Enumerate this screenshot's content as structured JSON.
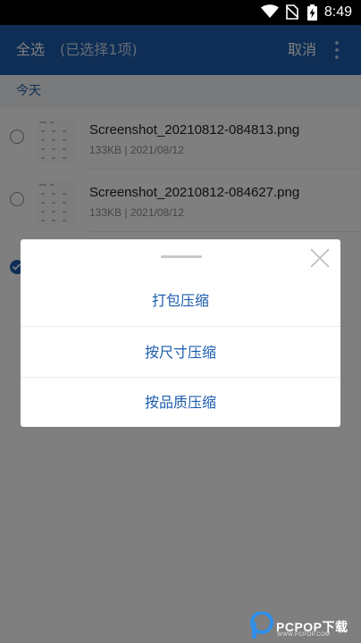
{
  "status_bar": {
    "time": "8:49",
    "icons": [
      "wifi-icon",
      "no-sim-icon",
      "battery-charging-icon"
    ]
  },
  "app_bar": {
    "select_all_label": "全选",
    "selected_count_label": "(已选择1项)",
    "cancel_label": "取消",
    "more_icon": "more-vertical-icon"
  },
  "section": {
    "title": "今天"
  },
  "files": [
    {
      "name": "Screenshot_20210812-084813.png",
      "size": "133KB",
      "date": "2021/08/12",
      "checked": false
    },
    {
      "name": "Screenshot_20210812-084627.png",
      "size": "133KB",
      "date": "2021/08/12",
      "checked": false
    },
    {
      "name": "",
      "size": "",
      "date": "",
      "checked": true
    }
  ],
  "dialog": {
    "close_icon": "close-icon",
    "options": [
      {
        "label": "打包压缩"
      },
      {
        "label": "按尺寸压缩"
      },
      {
        "label": "按品质压缩"
      }
    ]
  },
  "watermark": {
    "brand": "PCPOP下载",
    "sub": "WWW.PCPOP.COM"
  },
  "colors": {
    "accent": "#1c5dad",
    "status_bar": "#000000",
    "section_bg": "#f2f4f7",
    "overlay": "rgba(0,0,0,0.5)"
  }
}
